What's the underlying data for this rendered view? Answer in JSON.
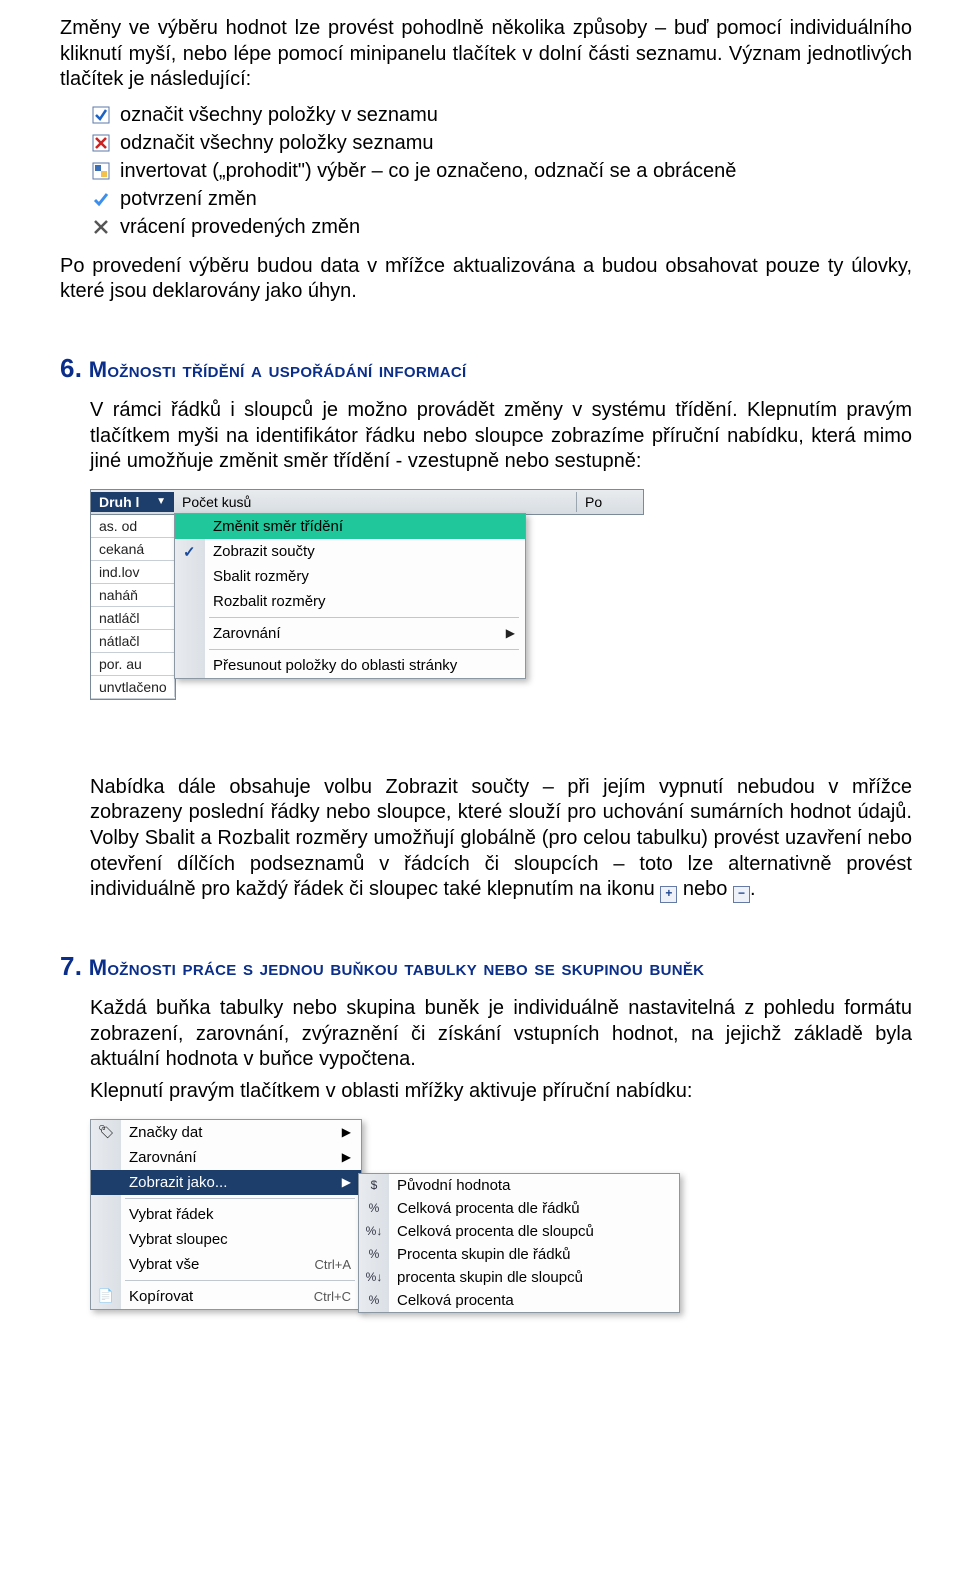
{
  "para1": "Změny ve výběru hodnot lze provést pohodlně několika způsoby – buď pomocí individuálního kliknutí myší, nebo lépe pomocí minipanelu tlačítek v dolní části seznamu. Význam jednotlivých tlačítek je následující:",
  "buttons": [
    "označit všechny položky v seznamu",
    "odznačit všechny položky seznamu",
    "invertovat („prohodit\") výběr – co je označeno, odznačí se a obráceně",
    "potvrzení změn",
    "vrácení provedených změn"
  ],
  "para2": "Po provedení výběru budou data v mřížce aktualizována a budou obsahovat pouze ty úlovky, které jsou deklarovány jako úhyn.",
  "sec6": {
    "num": "6.",
    "title": "Možnosti třídění a uspořádání informací"
  },
  "para6a": "V rámci řádků i sloupců je možno provádět změny v systému třídění. Klepnutím pravým tlačítkem myši na identifikátor řádku nebo sloupce zobrazíme příruční nabídku, která mimo jiné umožňuje změnit směr třídění  - vzestupně nebo sestupně:",
  "shot1": {
    "headers": [
      "Druh l",
      "Počet kusů",
      "Po"
    ],
    "rows": [
      "as. od",
      "cekaná",
      "ind.lov",
      "naháň",
      "natláčl",
      "nátlačl",
      "por. au",
      "unvtlačeno"
    ],
    "menu": {
      "change_sort": "Změnit směr třídění",
      "show_totals": "Zobrazit součty",
      "collapse": "Sbalit rozměry",
      "expand": "Rozbalit rozměry",
      "alignment": "Zarovnání",
      "move_to_page": "Přesunout položky do oblasti stránky"
    }
  },
  "para6b_1": "Nabídka dále obsahuje volbu Zobrazit součty – při jejím vypnutí nebudou v mřížce zobrazeny poslední řádky nebo sloupce, které slouží pro uchování sumárních hodnot údajů. Volby Sbalit a Rozbalit rozměry umožňují globálně (pro celou tabulku) provést uzavření nebo otevření dílčích podseznamů v řádcích či sloupcích – toto lze alternativně provést individuálně pro každý řádek či sloupec také klepnutím na ikonu ",
  "para6b_mid": " nebo ",
  "para6b_end": ".",
  "sec7": {
    "num": "7.",
    "title": "Možnosti práce s jednou buňkou tabulky nebo se skupinou buněk"
  },
  "para7a": "Každá buňka tabulky nebo skupina buněk je individuálně nastavitelná z pohledu formátu zobrazení, zarovnání, zvýraznění či získání vstupních hodnot, na jejichž základě byla aktuální hodnota v buňce vypočtena.",
  "para7b": "Klepnutí pravým tlačítkem v oblasti mřížky aktivuje příruční nabídku:",
  "shot2": {
    "menu": {
      "data_marks": "Značky dat",
      "alignment": "Zarovnání",
      "show_as": "Zobrazit jako...",
      "select_row": "Vybrat řádek",
      "select_col": "Vybrat sloupec",
      "select_all": "Vybrat vše",
      "select_all_sc": "Ctrl+A",
      "copy": "Kopírovat",
      "copy_sc": "Ctrl+C"
    },
    "sub": [
      {
        "ic": "$",
        "label": "Původní hodnota"
      },
      {
        "ic": "%",
        "label": "Celková procenta dle řádků"
      },
      {
        "ic": "%↓",
        "label": "Celková procenta dle sloupců"
      },
      {
        "ic": "%",
        "label": "Procenta skupin dle řádků"
      },
      {
        "ic": "%↓",
        "label": "procenta skupin dle sloupců"
      },
      {
        "ic": "%",
        "label": "Celková procenta"
      }
    ]
  }
}
